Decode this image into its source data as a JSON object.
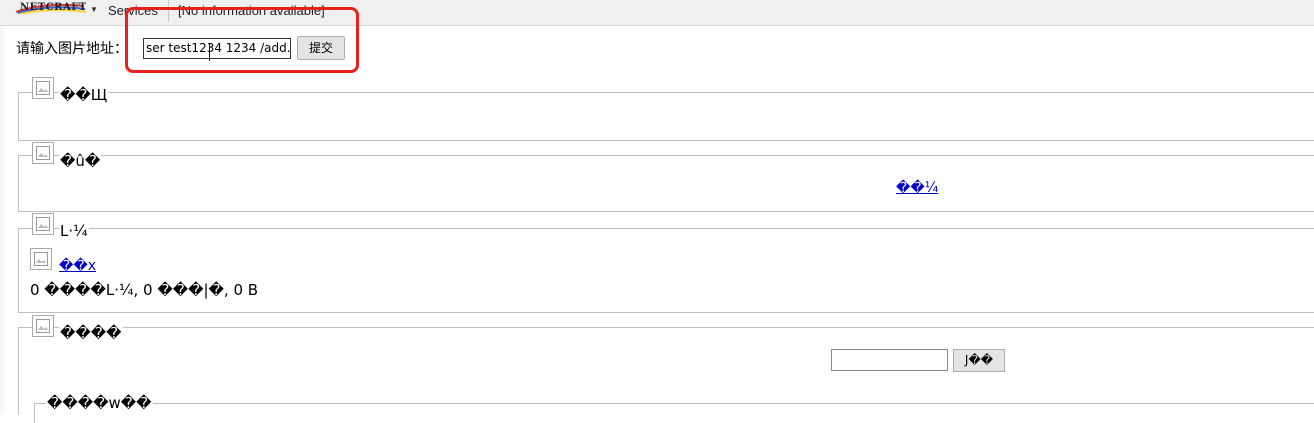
{
  "toolbar": {
    "logo_text": "NETCRAFT",
    "services_label": "Services",
    "info_text": "[No information available]"
  },
  "form": {
    "label": "请输入图片地址：",
    "input_value": "ser test1234 1234 /add.}",
    "submit_label": "提交"
  },
  "sections": [
    {
      "legend": "��Щ"
    },
    {
      "legend": "�û�",
      "link": "��¼"
    },
    {
      "legend": "L·¼",
      "link": "��x",
      "stats": "0 ����L·¼, 0 ���|�, 0 B"
    },
    {
      "legend": "����",
      "button_label": "J��"
    },
    {
      "legend": "����w��"
    }
  ],
  "colors": {
    "highlight": "#e8201e",
    "link": "#0000cc",
    "border": "#bdbdbd"
  },
  "icons": [
    "netcraft-logo",
    "chevron-down-icon",
    "broken-image-icon",
    "text-cursor-icon"
  ]
}
